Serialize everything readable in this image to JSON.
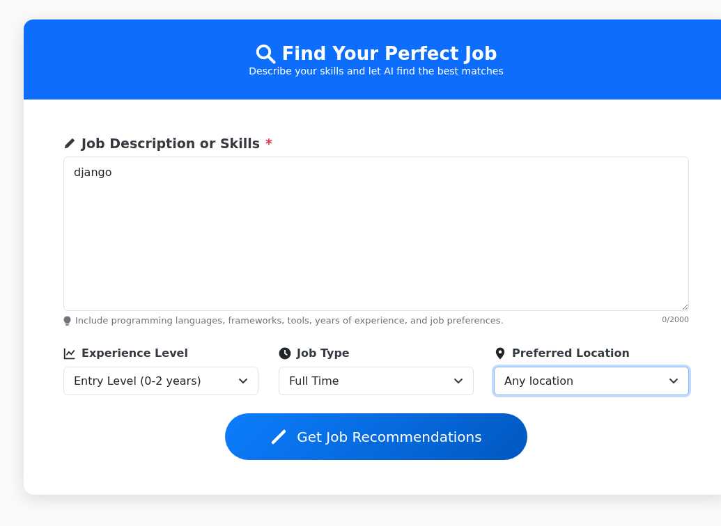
{
  "header": {
    "title": "Find Your Perfect Job",
    "subtitle": "Describe your skills and let AI find the best matches"
  },
  "description": {
    "label": "Job Description or Skills",
    "required_mark": "*",
    "value": "django",
    "hint": "Include programming languages, frameworks, tools, years of experience, and job preferences.",
    "counter": "0/2000"
  },
  "filters": [
    {
      "kind": "experience",
      "label": "Experience Level",
      "value": "Entry Level (0-2 years)",
      "focused": false
    },
    {
      "kind": "type",
      "label": "Job Type",
      "value": "Full Time",
      "focused": false
    },
    {
      "kind": "location",
      "label": "Preferred Location",
      "value": "Any location",
      "focused": true
    }
  ],
  "submit": {
    "label": "Get Job Recommendations"
  }
}
